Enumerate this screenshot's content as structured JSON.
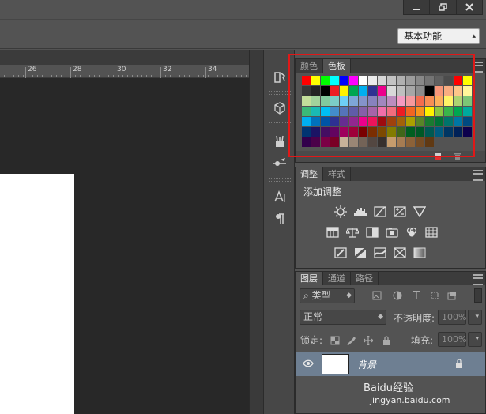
{
  "window": {
    "controls": [
      "minimize-icon",
      "restore-icon",
      "close-icon"
    ]
  },
  "options_bar": {
    "workspace_label": "基本功能"
  },
  "ruler": {
    "ticks": [
      "26",
      "28",
      "30",
      "32",
      "34"
    ]
  },
  "swatches_panel": {
    "tabs": [
      {
        "label": "颜色",
        "active": false
      },
      {
        "label": "色板",
        "active": true
      }
    ],
    "colors": [
      [
        "#ff0000",
        "#ffff00",
        "#00ff00",
        "#00ffff",
        "#0000ff",
        "#ff00ff",
        "#ffffff",
        "#ebebeb",
        "#d7d7d7",
        "#c3c3c3",
        "#b0b0b0",
        "#9c9c9c",
        "#888888",
        "#747474",
        "#606060",
        "#4c4c4c",
        "#ff0000",
        "#ffff00"
      ],
      [
        "#383838",
        "#242424",
        "#000000",
        "#ed1c24",
        "#fff200",
        "#00a651",
        "#00aeef",
        "#2e3192",
        "#ec008c",
        "#d9d9d9",
        "#bfbfbf",
        "#a6a6a6",
        "#8c8c8c",
        "#000000",
        "#f7977a",
        "#f9ad81",
        "#fdc68a",
        "#fff79a"
      ],
      [
        "#c4df9b",
        "#a3d39c",
        "#82ca9d",
        "#7bcdc8",
        "#6ecff6",
        "#7ea7d8",
        "#8493ca",
        "#8882be",
        "#a187be",
        "#bc8dbf",
        "#f49ac2",
        "#f6989d",
        "#f26c4f",
        "#f68e55",
        "#fbaf5c",
        "#fff467",
        "#acd372",
        "#7cc576"
      ],
      [
        "#3bb878",
        "#1abbb4",
        "#00bff3",
        "#438ccb",
        "#5574b9",
        "#605ca8",
        "#855fa8",
        "#a763a8",
        "#f06ea9",
        "#f26d7d",
        "#ed1c24",
        "#f26522",
        "#f7941d",
        "#fff200",
        "#8dc73f",
        "#39b54a",
        "#00a651",
        "#00a99d"
      ],
      [
        "#00aeef",
        "#0072bc",
        "#0054a6",
        "#2e3192",
        "#662d91",
        "#92278f",
        "#ec008c",
        "#ed145b",
        "#9e0b0f",
        "#a0410d",
        "#a36209",
        "#aba000",
        "#598527",
        "#197b30",
        "#007236",
        "#00746b",
        "#0076a3",
        "#004a80"
      ],
      [
        "#003471",
        "#1b1464",
        "#440e62",
        "#630460",
        "#9e005d",
        "#9e0039",
        "#790000",
        "#7b2e00",
        "#7d4900",
        "#827b00",
        "#406618",
        "#005e20",
        "#005826",
        "#005952",
        "#005b7f",
        "#003663",
        "#002157",
        "#0d004c"
      ],
      [
        "#32004b",
        "#4b0049",
        "#7b0046",
        "#7a0026",
        "#c7b299",
        "#998675",
        "#736357",
        "#534741",
        "#37302d",
        "#c69c6d",
        "#a67c52",
        "#8c6239",
        "#754c24",
        "#603913",
        "",
        "",
        "",
        ""
      ]
    ]
  },
  "adjustments_panel": {
    "tabs": [
      {
        "label": "调整",
        "active": true
      },
      {
        "label": "样式",
        "active": false
      }
    ],
    "title": "添加调整",
    "rows": [
      [
        "brightness-contrast-icon",
        "levels-icon",
        "curves-icon",
        "exposure-icon",
        "vibrance-icon"
      ],
      [
        "hue-saturation-icon",
        "color-balance-icon",
        "black-white-icon",
        "photo-filter-icon",
        "channel-mixer-icon",
        "color-lookup-icon"
      ],
      [
        "invert-icon",
        "posterize-icon",
        "threshold-icon",
        "selective-color-icon",
        "gradient-map-icon"
      ]
    ]
  },
  "layers_panel": {
    "tabs": [
      {
        "label": "图层",
        "active": true
      },
      {
        "label": "通道",
        "active": false
      },
      {
        "label": "路径",
        "active": false
      }
    ],
    "filter_label": "类型",
    "blend_mode": "正常",
    "opacity_label": "不透明度:",
    "opacity_value": "100%",
    "lock_label": "锁定:",
    "fill_label": "填充:",
    "fill_value": "100%",
    "layers": [
      {
        "name": "背景",
        "visible": true,
        "locked": true,
        "selected": true
      }
    ]
  },
  "watermark": {
    "brand": "Baidu经验",
    "url": "jingyan.baidu.com"
  }
}
